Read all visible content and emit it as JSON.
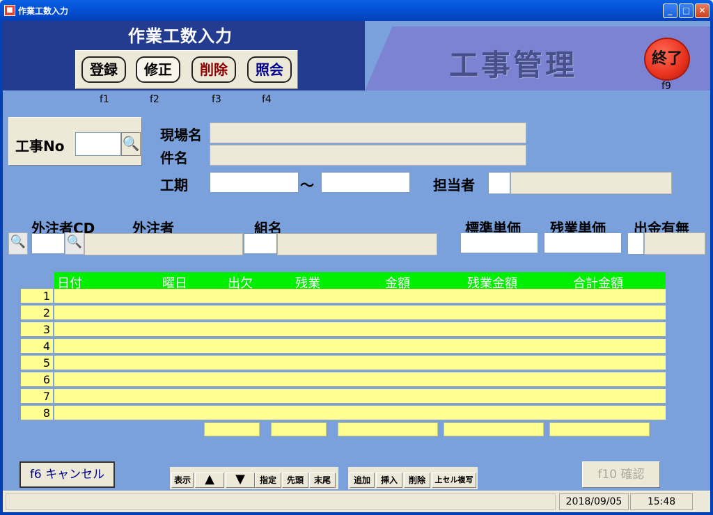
{
  "window": {
    "title": "作業工数入力",
    "icon": "app-icon"
  },
  "header": {
    "title": "作業工数入力",
    "brand": "工事管理",
    "buttons": [
      {
        "label": "登録",
        "key": "f1",
        "color": "#000000"
      },
      {
        "label": "修正",
        "key": "f2",
        "color": "#000000"
      },
      {
        "label": "削除",
        "key": "f3",
        "color": "#8b0000"
      },
      {
        "label": "照会",
        "key": "f4",
        "color": "#00008b"
      }
    ],
    "exit": {
      "label": "終了",
      "key": "f9"
    }
  },
  "form": {
    "koji_no_label": "工事No",
    "koji_no_value": "",
    "genba_label": "現場名",
    "kenmei_label": "件名",
    "kouki_label": "工期",
    "kouki_sep": "～",
    "tantou_label": "担当者",
    "gaichu_cd_label": "外注者CD",
    "gaichu_label": "外注者",
    "kumi_label": "組名",
    "hyojun_label": "標準単価",
    "zangyo_tanka_label": "残業単価",
    "shukkin_label": "出金有無"
  },
  "table": {
    "headers": [
      "日付",
      "曜日",
      "出欠",
      "残業",
      "金額",
      "残業金額",
      "合計金額"
    ],
    "rows": [
      "1",
      "2",
      "3",
      "4",
      "5",
      "6",
      "7",
      "8"
    ]
  },
  "footer": {
    "cancel_label": "f6 キャンセル",
    "confirm_label": "f10 確認",
    "nav_buttons": [
      "表示",
      "指定",
      "先頭",
      "末尾"
    ],
    "edit_buttons": [
      "追加",
      "挿入",
      "削除",
      "上セル複写"
    ]
  },
  "status": {
    "date": "2018/09/05",
    "time": "15:48"
  },
  "colors": {
    "header_dark": "#233c8f",
    "client_bg": "#7ba1dc",
    "table_header": "#00ee00",
    "table_cell": "#ffff8f"
  }
}
